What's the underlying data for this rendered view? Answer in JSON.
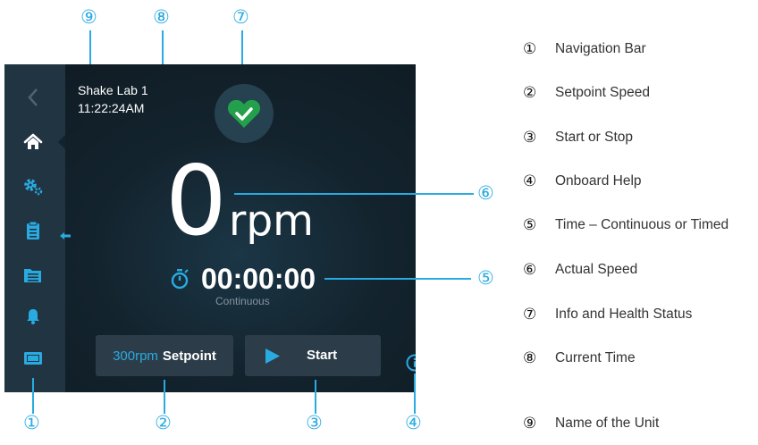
{
  "callouts": [
    "①",
    "②",
    "③",
    "④",
    "⑤",
    "⑥",
    "⑦",
    "⑧",
    "⑨"
  ],
  "device": {
    "unit_name": "Shake Lab 1",
    "current_time": "11:22:24AM",
    "speed_value": "0",
    "speed_unit": "rpm",
    "timer": "00:00:00",
    "timer_mode": "Continuous",
    "setpoint_value": "300rpm",
    "setpoint_label": "Setpoint",
    "start_label": "Start",
    "status": "healthy",
    "colors": {
      "accent": "#29abe2",
      "status_green": "#22a04b",
      "screen_bg": "#13232d",
      "navbar": "#213441"
    }
  },
  "nav_icons": [
    "back-chevron-icon",
    "home-icon",
    "gears-icon",
    "clipboard-icon",
    "folder-icon",
    "bell-icon",
    "display-icon"
  ],
  "legend": [
    {
      "num": "①",
      "text": "Navigation Bar"
    },
    {
      "num": "②",
      "text": "Setpoint Speed"
    },
    {
      "num": "③",
      "text": "Start or Stop"
    },
    {
      "num": "④",
      "text": "Onboard Help"
    },
    {
      "num": "⑤",
      "text": "Time – Continuous or Timed"
    },
    {
      "num": "⑥",
      "text": "Actual Speed"
    },
    {
      "num": "⑦",
      "text": "Info and Health Status"
    },
    {
      "num": "⑧",
      "text": "Current Time"
    },
    {
      "num": "⑨",
      "text": "Name of the Unit"
    }
  ]
}
